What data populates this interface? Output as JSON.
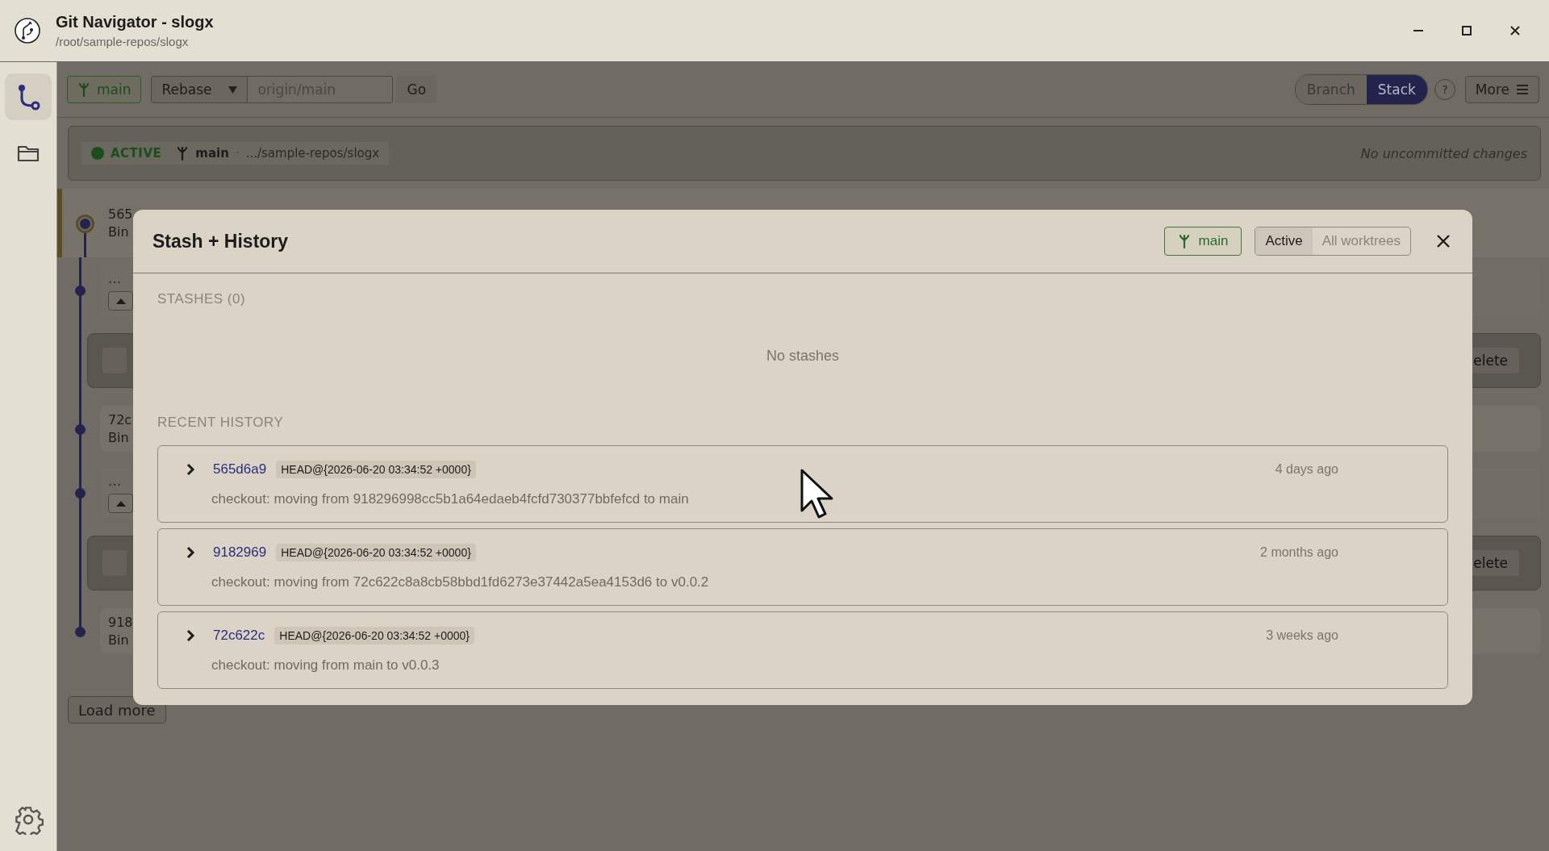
{
  "window": {
    "title": "Git Navigator - slogx",
    "subtitle": "/root/sample-repos/slogx"
  },
  "sidebar": {
    "items": [
      {
        "kind": "graph",
        "selected": true
      },
      {
        "kind": "folder",
        "selected": false
      }
    ]
  },
  "toolbar": {
    "branch": "main",
    "mode": "Rebase",
    "target_placeholder": "origin/main",
    "go": "Go",
    "view_tabs": [
      {
        "label": "Branch",
        "selected": false
      },
      {
        "label": "Stack",
        "selected": true
      }
    ],
    "help": "?",
    "more": "More"
  },
  "worktree": {
    "status": "ACTIVE",
    "branch": "main",
    "separator": "·",
    "path": ".../sample-repos/slogx",
    "changes": "No uncommitted changes"
  },
  "commits": [
    {
      "kind": "commit",
      "hash": "565",
      "author": "Bin",
      "selected": true
    },
    {
      "kind": "collapsed",
      "text": "..."
    },
    {
      "kind": "action",
      "action": "elete"
    },
    {
      "kind": "commit",
      "hash": "72c",
      "author": "Bin",
      "selected": false
    },
    {
      "kind": "collapsed",
      "text": "..."
    },
    {
      "kind": "action",
      "action": "elete"
    },
    {
      "kind": "commit",
      "hash": "918",
      "author": "Bin",
      "selected": false
    }
  ],
  "load_more": "Load more",
  "dialog": {
    "title": "Stash + History",
    "branch": "main",
    "scope_tabs": [
      {
        "label": "Active",
        "selected": true
      },
      {
        "label": "All worktrees",
        "selected": false
      }
    ],
    "stashes_heading": "STASHES (0)",
    "stashes_empty": "No stashes",
    "history_heading": "RECENT HISTORY",
    "history": [
      {
        "hash": "565d6a9",
        "ref": "HEAD@{2026-06-20 03:34:52 +0000}",
        "time": "4 days ago",
        "message": "checkout: moving from 918296998cc5b1a64edaeb4fcfd730377bbfefcd to main",
        "expanded": false
      },
      {
        "hash": "9182969",
        "ref": "HEAD@{2026-06-20 03:34:52 +0000}",
        "time": "2 months ago",
        "message": "checkout: moving from 72c622c8a8cb58bbd1fd6273e37442a5ea4153d6 to v0.0.2",
        "expanded": false
      },
      {
        "hash": "72c622c",
        "ref": "HEAD@{2026-06-20 03:34:52 +0000}",
        "time": "3 weeks ago",
        "message": "checkout: moving from main to v0.0.3",
        "expanded": false
      }
    ]
  }
}
